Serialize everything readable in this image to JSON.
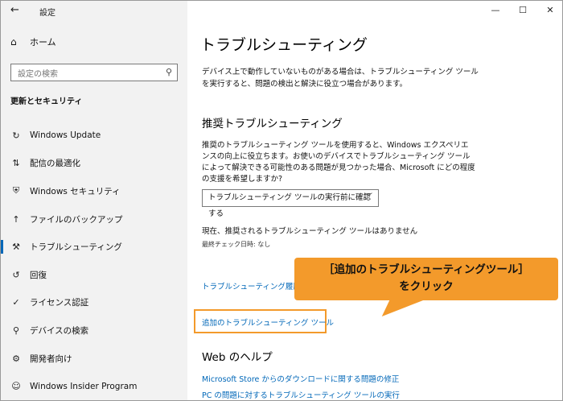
{
  "sidebar": {
    "back_glyph": "←",
    "app_title": "設定",
    "home_label": "ホーム",
    "search_placeholder": "設定の検索",
    "section_title": "更新とセキュリティ",
    "items": [
      {
        "label": "Windows Update",
        "icon": "sync-icon",
        "glyph": "↻"
      },
      {
        "label": "配信の最適化",
        "icon": "delivery-optimization-icon",
        "glyph": "⇅"
      },
      {
        "label": "Windows セキュリティ",
        "icon": "shield-icon",
        "glyph": "⛨"
      },
      {
        "label": "ファイルのバックアップ",
        "icon": "backup-icon",
        "glyph": "↑"
      },
      {
        "label": "トラブルシューティング",
        "icon": "wrench-icon",
        "glyph": "⚒"
      },
      {
        "label": "回復",
        "icon": "recovery-icon",
        "glyph": "↺"
      },
      {
        "label": "ライセンス認証",
        "icon": "check-circle-icon",
        "glyph": "✓"
      },
      {
        "label": "デバイスの検索",
        "icon": "find-device-icon",
        "glyph": "⚲"
      },
      {
        "label": "開発者向け",
        "icon": "developer-icon",
        "glyph": "⚙"
      },
      {
        "label": "Windows Insider Program",
        "icon": "insider-icon",
        "glyph": "☺"
      }
    ]
  },
  "window": {
    "minimize": "—",
    "maximize": "☐",
    "close": "✕"
  },
  "main": {
    "title": "トラブルシューティング",
    "description": "デバイス上で動作していないものがある場合は、トラブルシューティング ツールを実行すると、問題の検出と解決に役立つ場合があります。",
    "recommended_heading": "推奨トラブルシューティング",
    "recommended_desc": "推奨のトラブルシューティング ツールを使用すると、Windows エクスペリエンスの向上に役立ちます。お使いのデバイスでトラブルシューティング ツールによって解決できる可能性のある問題が見つかった場合、Microsoft にどの程度の支援を希望しますか?",
    "dropdown_value": "トラブルシューティング ツールの実行前に確認する",
    "status": "現在、推奨されるトラブルシューティング ツールはありません",
    "last_check": "最終チェック日時: なし",
    "history_link": "トラブルシューティング履歴の表",
    "additional_link": "追加のトラブルシューティング ツール",
    "web_help_heading": "Web のヘルプ",
    "help_links": [
      "Microsoft Store からのダウンロードに関する問題の修正",
      "PC の問題に対するトラブルシューティング ツールの実行"
    ]
  },
  "callout": {
    "line1": "［追加のトラブルシューティングツール］",
    "line2": "をクリック"
  },
  "colors": {
    "accent": "#0067b8",
    "callout": "#f39a2b",
    "sidebar_bg": "#f2f2f2"
  }
}
